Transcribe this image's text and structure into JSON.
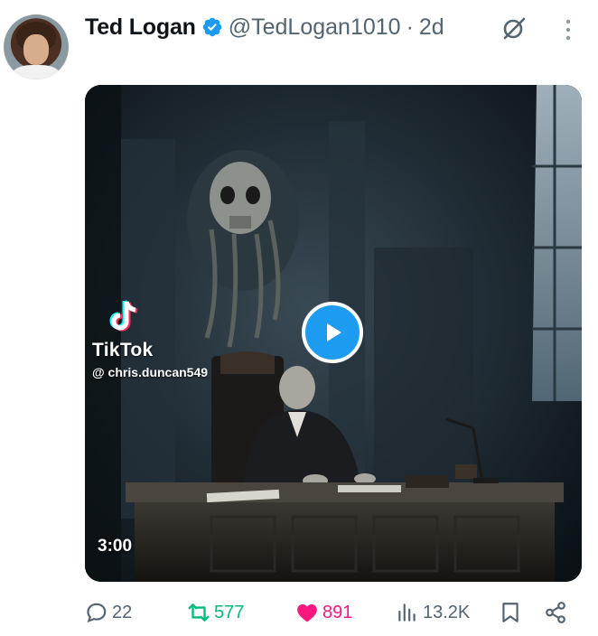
{
  "author": {
    "display_name": "Ted Logan",
    "handle": "@TedLogan1010",
    "separator": "·",
    "time": "2d",
    "verified": true
  },
  "media": {
    "watermark_brand": "TikTok",
    "watermark_user": "@ chris.duncan549",
    "duration": "3:00"
  },
  "actions": {
    "replies": "22",
    "reposts": "577",
    "likes": "891",
    "views": "13.2K"
  },
  "colors": {
    "verified_blue": "#1d9bf0",
    "repost_green": "#00ba7c",
    "like_pink": "#f91880",
    "muted_gray": "#536471"
  },
  "icons": [
    "verified-badge-icon",
    "grok-icon",
    "more-icon",
    "tiktok-logo-icon",
    "play-icon",
    "reply-icon",
    "repost-icon",
    "like-icon",
    "views-icon",
    "bookmark-icon",
    "share-icon"
  ]
}
